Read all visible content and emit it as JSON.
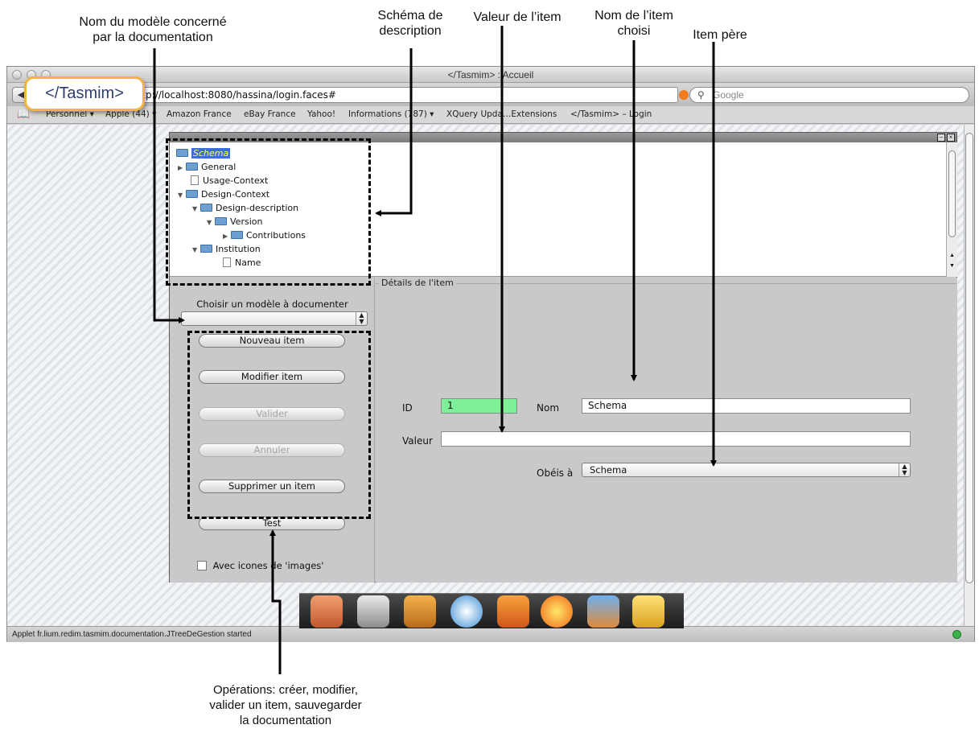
{
  "annotations": {
    "model_name": "Nom du modèle concerné\npar la documentation",
    "schema": "Schéma de\ndescription",
    "item_value": "Valeur de l’item",
    "item_name": "Nom de l’item\nchoisi",
    "parent_item": "Item père",
    "operations": "Opérations: créer, modifier,\nvalider un item, sauvegarder\nla documentation"
  },
  "browser": {
    "window_title": "</Tasmim> : Accueil",
    "url": "http://localhost:8080/hassina/login.faces#",
    "search_placeholder": "Google",
    "bookmarks": [
      "Personnel ▾",
      "Apple (44) ▾",
      "Amazon France",
      "eBay France",
      "Yahoo!",
      "Informations (787) ▾",
      "XQuery Upda…Extensions",
      "</Tasmim> – Login"
    ],
    "status": "Applet fr.lium.redim.tasmim.documentation.JTreeDeGestion started"
  },
  "logo": "</Tasmim>",
  "tree": {
    "nodes": [
      {
        "label": "Schema",
        "type": "folder",
        "expanded": null,
        "selected": true
      },
      {
        "label": "General",
        "type": "folder",
        "expanded": false
      },
      {
        "label": "Usage-Context",
        "type": "file"
      },
      {
        "label": "Design-Context",
        "type": "folder",
        "expanded": true
      },
      {
        "label": "Design-description",
        "type": "folder",
        "expanded": true
      },
      {
        "label": "Version",
        "type": "folder",
        "expanded": true
      },
      {
        "label": "Contributions",
        "type": "folder",
        "expanded": false
      },
      {
        "label": "Institution",
        "type": "folder",
        "expanded": true
      },
      {
        "label": "Name",
        "type": "file"
      }
    ]
  },
  "left_panel": {
    "model_select_label": "Choisir un modèle à documenter",
    "model_select_value": "",
    "buttons": {
      "new": "Nouveau item",
      "modify": "Modifier item",
      "validate": "Valider",
      "cancel": "Annuler",
      "delete": "Supprimer un item",
      "test": "Test"
    },
    "icons_checkbox_label": "Avec icones de 'images'",
    "icons_checkbox_checked": false
  },
  "details": {
    "legend": "Détails de l'item",
    "id_label": "ID",
    "id_value": "1",
    "name_label": "Nom",
    "name_value": "Schema",
    "value_label": "Valeur",
    "value_value": "",
    "obeys_label": "Obéis à",
    "obeys_value": "Schema"
  },
  "colors": {
    "id_field_bg": "#7ef09a",
    "selection": "#3b6fd6",
    "logo_border": "#f3b444"
  }
}
